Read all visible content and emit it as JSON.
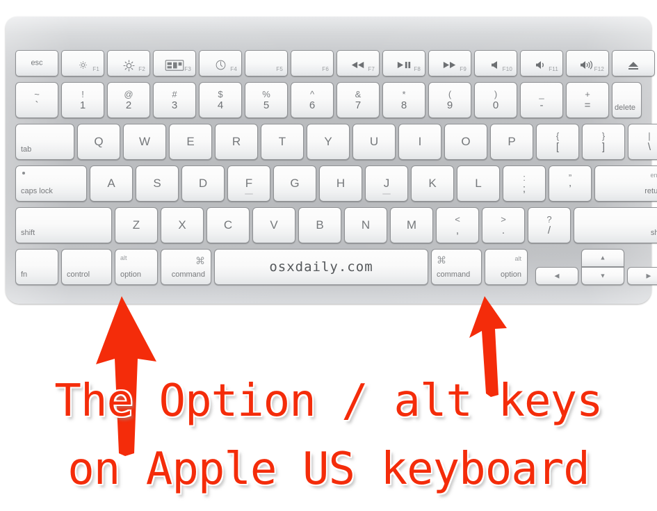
{
  "meta": {
    "device": "Apple US keyboard",
    "accent_color": "#f42c0a",
    "body_color": "#babcbf",
    "key_color": "#fafafa"
  },
  "keyboard": {
    "rows": {
      "function_row": [
        {
          "name": "esc",
          "center": "esc"
        },
        {
          "name": "f1",
          "icon": "brightness-down-icon",
          "fn": "F1"
        },
        {
          "name": "f2",
          "icon": "brightness-up-icon",
          "fn": "F2"
        },
        {
          "name": "f3",
          "icon": "mission-control-icon",
          "fn": "F3"
        },
        {
          "name": "f4",
          "icon": "dashboard-icon",
          "fn": "F4"
        },
        {
          "name": "f5",
          "icon": "",
          "fn": "F5"
        },
        {
          "name": "f6",
          "icon": "",
          "fn": "F6"
        },
        {
          "name": "f7",
          "icon": "rewind-icon",
          "fn": "F7"
        },
        {
          "name": "f8",
          "icon": "play-pause-icon",
          "fn": "F8"
        },
        {
          "name": "f9",
          "icon": "fast-forward-icon",
          "fn": "F9"
        },
        {
          "name": "f10",
          "icon": "mute-icon",
          "fn": "F10"
        },
        {
          "name": "f11",
          "icon": "volume-down-icon",
          "fn": "F11"
        },
        {
          "name": "f12",
          "icon": "volume-up-icon",
          "fn": "F12"
        },
        {
          "name": "eject",
          "icon": "eject-icon",
          "fn": ""
        }
      ],
      "number_row": [
        {
          "name": "tilde",
          "top": "~",
          "bottom": "`"
        },
        {
          "name": "one",
          "top": "!",
          "bottom": "1"
        },
        {
          "name": "two",
          "top": "@",
          "bottom": "2"
        },
        {
          "name": "three",
          "top": "#",
          "bottom": "3"
        },
        {
          "name": "four",
          "top": "$",
          "bottom": "4"
        },
        {
          "name": "five",
          "top": "%",
          "bottom": "5"
        },
        {
          "name": "six",
          "top": "^",
          "bottom": "6"
        },
        {
          "name": "seven",
          "top": "&",
          "bottom": "7"
        },
        {
          "name": "eight",
          "top": "*",
          "bottom": "8"
        },
        {
          "name": "nine",
          "top": "(",
          "bottom": "9"
        },
        {
          "name": "zero",
          "top": ")",
          "bottom": "0"
        },
        {
          "name": "minus",
          "top": "_",
          "bottom": "-"
        },
        {
          "name": "equal",
          "top": "+",
          "bottom": "="
        },
        {
          "name": "delete",
          "br": "delete"
        }
      ],
      "qwerty_row": [
        {
          "name": "tab",
          "bl": "tab"
        },
        {
          "name": "q",
          "alpha": "Q"
        },
        {
          "name": "w",
          "alpha": "W"
        },
        {
          "name": "e",
          "alpha": "E"
        },
        {
          "name": "r",
          "alpha": "R"
        },
        {
          "name": "t",
          "alpha": "T"
        },
        {
          "name": "y",
          "alpha": "Y"
        },
        {
          "name": "u",
          "alpha": "U"
        },
        {
          "name": "i",
          "alpha": "I"
        },
        {
          "name": "o",
          "alpha": "O"
        },
        {
          "name": "p",
          "alpha": "P"
        },
        {
          "name": "bracket-left",
          "top": "{",
          "bottom": "["
        },
        {
          "name": "bracket-right",
          "top": "}",
          "bottom": "]"
        },
        {
          "name": "backslash",
          "top": "|",
          "bottom": "\\"
        }
      ],
      "home_row": [
        {
          "name": "caps-lock",
          "bl": "caps lock",
          "dot": true
        },
        {
          "name": "a",
          "alpha": "A"
        },
        {
          "name": "s",
          "alpha": "S"
        },
        {
          "name": "d",
          "alpha": "D"
        },
        {
          "name": "f",
          "alpha": "F",
          "bump": true
        },
        {
          "name": "g",
          "alpha": "G"
        },
        {
          "name": "h",
          "alpha": "H"
        },
        {
          "name": "j",
          "alpha": "J",
          "bump": true
        },
        {
          "name": "k",
          "alpha": "K"
        },
        {
          "name": "l",
          "alpha": "L"
        },
        {
          "name": "semicolon",
          "top": ":",
          "bottom": ";"
        },
        {
          "name": "quote",
          "top": "”",
          "bottom": "’"
        },
        {
          "name": "return",
          "tr": "enter",
          "br": "return"
        }
      ],
      "shift_row": [
        {
          "name": "shift-left",
          "bl": "shift"
        },
        {
          "name": "z",
          "alpha": "Z"
        },
        {
          "name": "x",
          "alpha": "X"
        },
        {
          "name": "c",
          "alpha": "C"
        },
        {
          "name": "v",
          "alpha": "V"
        },
        {
          "name": "b",
          "alpha": "B"
        },
        {
          "name": "n",
          "alpha": "N"
        },
        {
          "name": "m",
          "alpha": "M"
        },
        {
          "name": "comma",
          "top": "<",
          "bottom": ","
        },
        {
          "name": "period",
          "top": ">",
          "bottom": "."
        },
        {
          "name": "slash",
          "top": "?",
          "bottom": "/"
        },
        {
          "name": "shift-right",
          "br": "shift"
        }
      ],
      "bottom_row": [
        {
          "name": "fn",
          "bl": "fn"
        },
        {
          "name": "control-left",
          "bl": "control"
        },
        {
          "name": "option-left",
          "tl": "alt",
          "bl": "option",
          "highlight": true
        },
        {
          "name": "command-left",
          "tr": "⌘",
          "br": "command"
        },
        {
          "name": "space",
          "center": "osxdaily.com"
        },
        {
          "name": "command-right",
          "tl": "⌘",
          "bl": "command"
        },
        {
          "name": "option-right",
          "tr": "alt",
          "br": "option",
          "highlight": true
        },
        {
          "name": "arrow-left",
          "glyph": "◀"
        },
        {
          "name": "arrow-up",
          "glyph": "▲"
        },
        {
          "name": "arrow-down",
          "glyph": "▼"
        },
        {
          "name": "arrow-right",
          "glyph": "▶"
        }
      ]
    }
  },
  "annotation": {
    "arrows": [
      {
        "name": "pointer-arrow-left-option",
        "points_to": "option-left"
      },
      {
        "name": "pointer-arrow-right-option",
        "points_to": "option-right"
      }
    ],
    "caption_line1": "The Option / alt keys",
    "caption_line2": "on Apple US keyboard"
  },
  "watermark": {
    "text": "osxdaily.com"
  }
}
